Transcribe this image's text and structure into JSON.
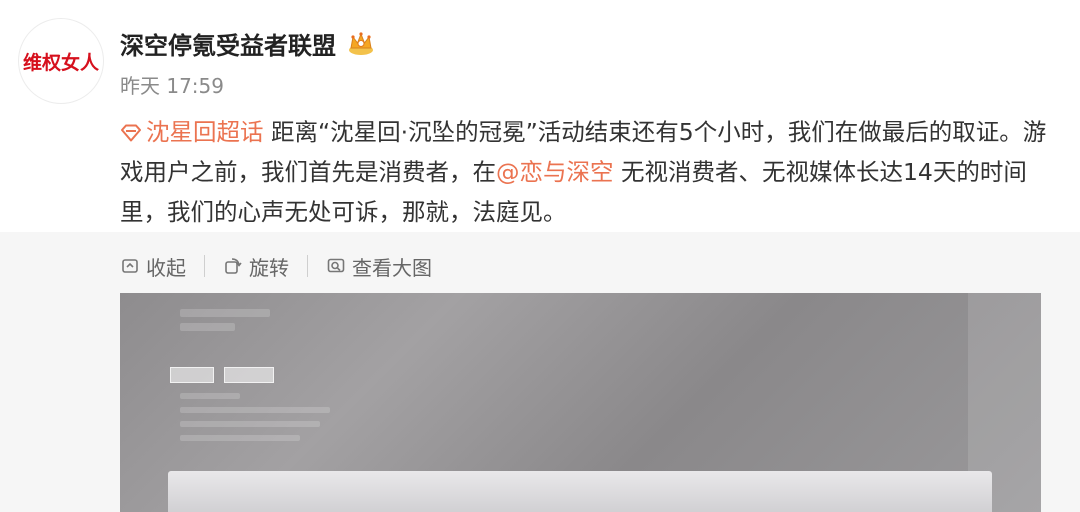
{
  "post": {
    "avatar_text": "维权女人",
    "username": "深空停氪受益者联盟",
    "timestamp": "昨天 17:59",
    "topic": "沈星回超话",
    "text_part1": "距离“沈星回·沉坠的冠冕”活动结束还有5个小时，我们在做最后的取证。游戏用户之前，我们首先是消费者，在",
    "mention": "@恋与深空",
    "text_part2": " 无视消费者、无视媒体长达14天的时间里，我们的心声无处可诉，那就，法庭见。"
  },
  "media_actions": {
    "collapse": "收起",
    "rotate": "旋转",
    "view_large": "查看大图"
  },
  "colors": {
    "link": "#eb7350",
    "avatar_red": "#d6101d",
    "panel_bg": "#f6f6f6"
  },
  "icons": [
    "crown-badge-icon",
    "super-topic-diamond-icon",
    "collapse-icon",
    "rotate-icon",
    "view-large-icon"
  ]
}
